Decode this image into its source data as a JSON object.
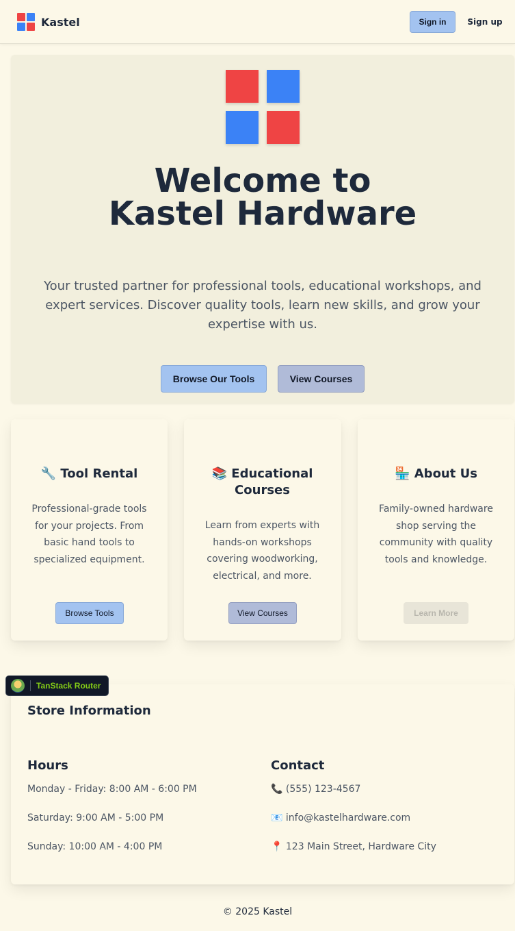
{
  "colors": {
    "red": "#ef4444",
    "blue": "#3b82f6",
    "background": "#fcf8e8",
    "primary_button": "#a3c3f0",
    "secondary_button": "#b0bbd8"
  },
  "header": {
    "brand": "Kastel",
    "logo_icon": "four-squares-logo-icon",
    "sign_in": "Sign in",
    "sign_up": "Sign up"
  },
  "hero": {
    "title": "Welcome to Kastel Hardware",
    "description": "Your trusted partner for professional tools, educational workshops, and expert services. Discover quality tools, learn new skills, and grow your expertise with us.",
    "browse_button": "Browse Our Tools",
    "courses_button": "View Courses"
  },
  "cards": [
    {
      "icon": "🔧",
      "icon_name": "wrench-icon",
      "title": "Tool Rental",
      "text": "Professional-grade tools for your projects. From basic hand tools to specialized equipment.",
      "button": "Browse Tools"
    },
    {
      "icon": "📚",
      "icon_name": "books-icon",
      "title": "Educational Courses",
      "text": "Learn from experts with hands-on workshops covering woodworking, electrical, and more.",
      "button": "View Courses"
    },
    {
      "icon": "🏪",
      "icon_name": "store-icon",
      "title": "About Us",
      "text": "Family-owned hardware shop serving the community with quality tools and knowledge.",
      "button": "Learn More"
    }
  ],
  "devtools": {
    "label": "TanStack Router",
    "icon_name": "tanstack-logo-icon"
  },
  "store": {
    "title": "Store Information",
    "hours": {
      "title": "Hours",
      "lines": [
        "Monday - Friday: 8:00 AM - 6:00 PM",
        "Saturday: 9:00 AM - 5:00 PM",
        "Sunday: 10:00 AM - 4:00 PM"
      ]
    },
    "contact": {
      "title": "Contact",
      "phone_icon": "📞",
      "phone": "(555) 123-4567",
      "email_icon": "📧",
      "email": "info@kastelhardware.com",
      "address_icon": "📍",
      "address": "123 Main Street, Hardware City"
    }
  },
  "footer": {
    "copyright": "© 2025 Kastel"
  }
}
